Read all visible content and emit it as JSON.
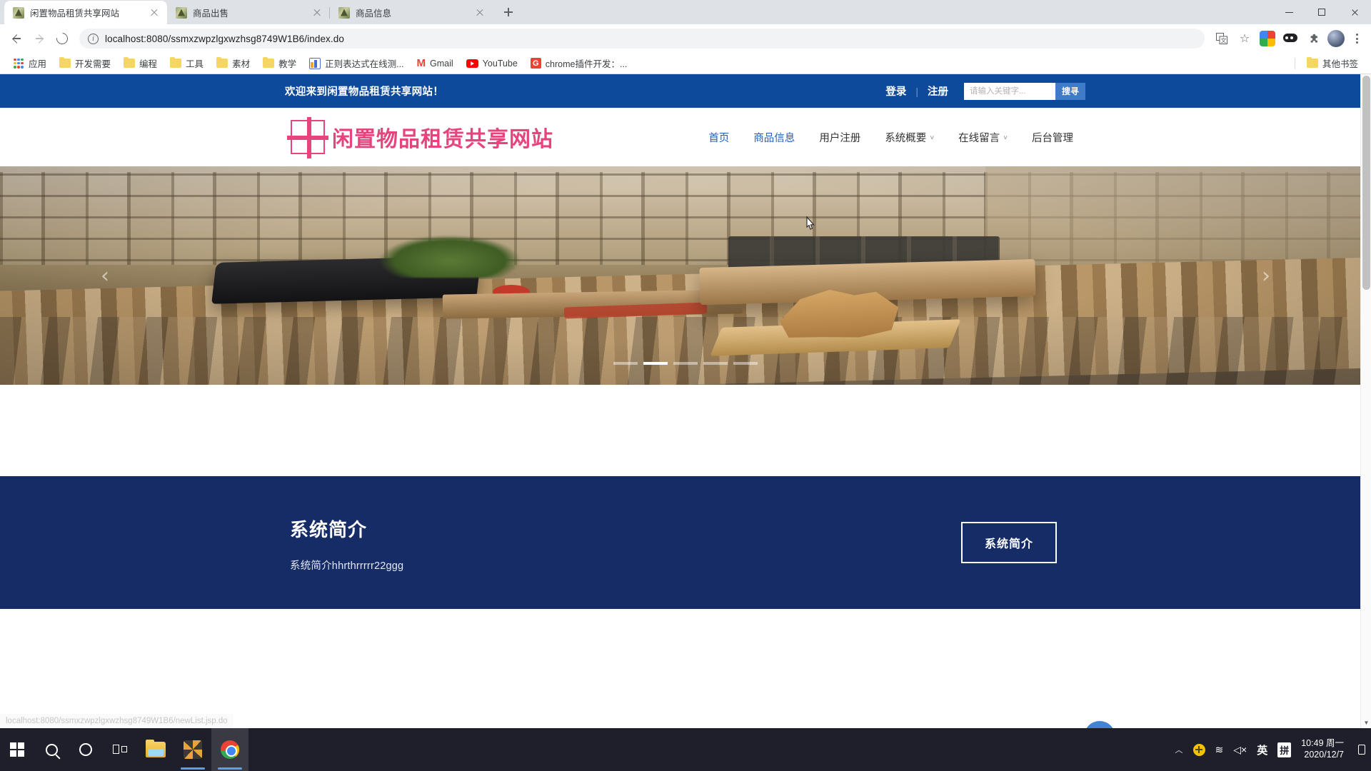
{
  "browser": {
    "tabs": [
      {
        "title": "闲置物品租赁共享网站",
        "active": true
      },
      {
        "title": "商品出售",
        "active": false
      },
      {
        "title": "商品信息",
        "active": false
      }
    ],
    "new_tab_label": "+",
    "window_controls": {
      "minimize": "–",
      "maximize": "□",
      "close": "×"
    },
    "omnibox": {
      "url": "localhost:8080/ssmxzwpzlgxwzhsg8749W1B6/index.do",
      "info_glyph": "i",
      "star_glyph": "☆"
    },
    "toolbar_icons": [
      "translate-icon",
      "bookmark-star-icon",
      "google-photos-extension",
      "dark-reader-extension",
      "extensions-puzzle-icon",
      "profile-avatar",
      "chrome-menu-icon"
    ],
    "bookmarks": [
      {
        "label": "应用",
        "icon": "apps-grid-icon"
      },
      {
        "label": "开发需要",
        "icon": "folder-icon"
      },
      {
        "label": "编程",
        "icon": "folder-icon"
      },
      {
        "label": "工具",
        "icon": "folder-icon"
      },
      {
        "label": "素材",
        "icon": "folder-icon"
      },
      {
        "label": "教学",
        "icon": "folder-icon"
      },
      {
        "label": "正则表达式在线测...",
        "icon": "regex-site-icon"
      },
      {
        "label": "Gmail",
        "icon": "gmail-icon"
      },
      {
        "label": "YouTube",
        "icon": "youtube-icon"
      },
      {
        "label": "chrome插件开发：...",
        "icon": "chrome-ext-icon"
      }
    ],
    "other_bookmarks": "其他书签",
    "status_bar_url": "localhost:8080/ssmxzwpzlgxwzhsg8749W1B6/newList.jsp.do"
  },
  "site": {
    "topbar": {
      "welcome": "欢迎来到闲置物品租赁共享网站！",
      "login": "登录",
      "divider": "|",
      "register": "注册",
      "search_placeholder": "请输入关键字...",
      "search_button": "搜寻",
      "bg_color": "#0d4a9c"
    },
    "header": {
      "logo_text": "闲置物品租赁共享网站",
      "logo_color": "#e5447d",
      "nav": [
        {
          "label": "首页",
          "active": true,
          "caret": false
        },
        {
          "label": "商品信息",
          "active": true,
          "caret": false
        },
        {
          "label": "用户注册",
          "active": false,
          "caret": false
        },
        {
          "label": "系统概要",
          "active": false,
          "caret": true
        },
        {
          "label": "在线留言",
          "active": false,
          "caret": true
        },
        {
          "label": "后台管理",
          "active": false,
          "caret": false
        }
      ],
      "caret_glyph": "˅"
    },
    "hero": {
      "prev_glyph": "‹",
      "next_glyph": "›",
      "slide_count": 5,
      "active_slide": 2,
      "alt": "furniture-showroom-banner"
    },
    "intro": {
      "title": "系统简介",
      "body": "系统简介hhrthrrrrr22ggg",
      "button": "系统简介",
      "bg_color": "#152c66"
    },
    "scrollbar": {
      "up_glyph": "▲",
      "down_glyph": "▼"
    }
  },
  "taskbar": {
    "start": "windows-start-icon",
    "items": [
      "search-icon",
      "cortana-icon",
      "task-view-icon",
      "file-explorer-icon",
      "app-icon",
      "chrome-icon"
    ],
    "tray": {
      "caret": "︿",
      "security_icon": "security-shield-icon",
      "wifi_icon": "≋",
      "volume_icon": "◁×",
      "ime_lang": "英",
      "ime_mode": "拼",
      "time": "10:49 周一",
      "date": "2020/12/7"
    }
  }
}
